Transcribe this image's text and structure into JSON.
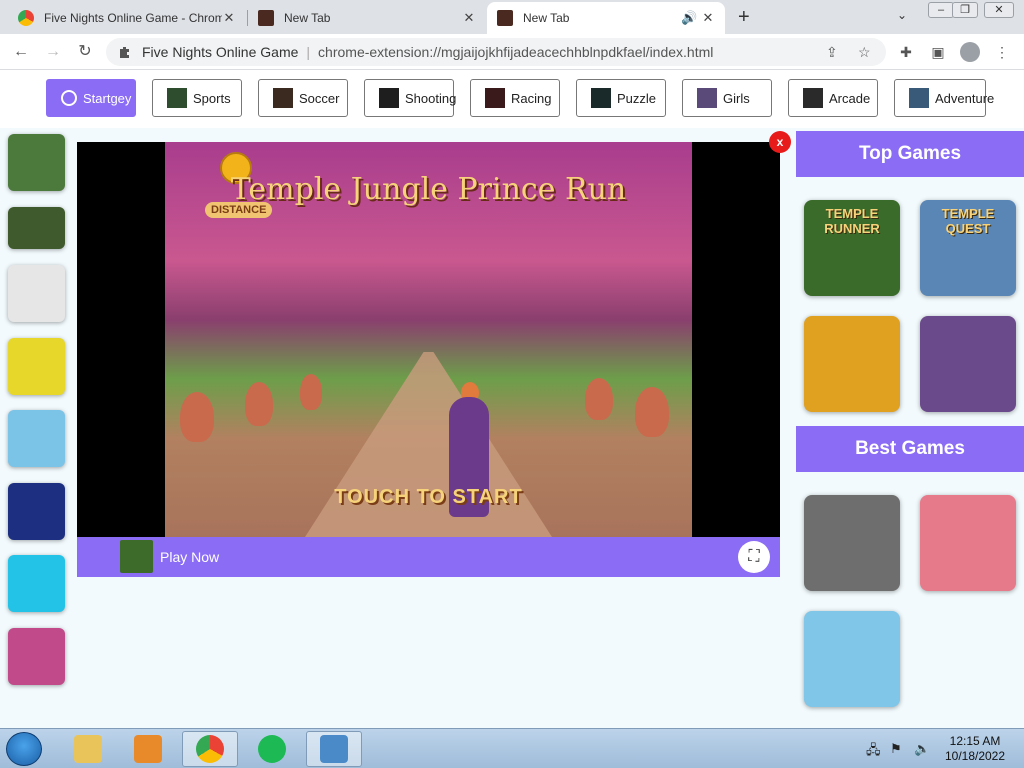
{
  "browser": {
    "tabs": [
      {
        "title": "Five Nights Online Game - Chrom",
        "active": false
      },
      {
        "title": "New Tab",
        "active": false
      },
      {
        "title": "New Tab",
        "active": true,
        "audio": true
      }
    ],
    "new_tab_symbol": "+",
    "address": {
      "site": "Five Nights Online Game",
      "url": "chrome-extension://mgjaijojkhfijadeacechhblnpdkfael/index.html"
    }
  },
  "categories": [
    {
      "label": "Startgey",
      "active": true
    },
    {
      "label": "Sports"
    },
    {
      "label": "Soccer"
    },
    {
      "label": "Shooting"
    },
    {
      "label": "Racing"
    },
    {
      "label": "Puzzle"
    },
    {
      "label": "Girls"
    },
    {
      "label": "Arcade"
    },
    {
      "label": "Adventure"
    }
  ],
  "left_thumbs": [
    {
      "icon": "thief-game-thumb",
      "color": "#4b7a3c"
    },
    {
      "icon": "forest-shooter-thumb",
      "color": "#3f5a2c"
    },
    {
      "icon": "stickman-thumb",
      "color": "#e6e6e6"
    },
    {
      "icon": "pipe-puzzle-thumb",
      "color": "#e7d72a"
    },
    {
      "icon": "car-racing-thumb",
      "color": "#7cc3e8"
    },
    {
      "icon": "huggy-wuggy-thumb",
      "color": "#1d2f80"
    },
    {
      "icon": "spider-hero-thumb",
      "color": "#22c3e6"
    },
    {
      "icon": "meteor-hunter-thumb",
      "color": "#c04a8a"
    }
  ],
  "game": {
    "title": "Temple Jungle Prince Run",
    "distance_label": "DISTANCE",
    "touch_label": "TOUCH TO START",
    "close_label": "x",
    "play_now": "Play Now"
  },
  "sidebar": {
    "top_title": "Top Games",
    "top_games": [
      {
        "label": "TEMPLE RUNNER",
        "color": "#3a6b2a"
      },
      {
        "label": "TEMPLE QUEST",
        "color": "#5a86b5"
      },
      {
        "label": "",
        "color": "#e0a020"
      },
      {
        "label": "",
        "color": "#6a4a8a"
      }
    ],
    "best_title": "Best Games",
    "best_games": [
      {
        "label": "",
        "color": "#6e6e6e"
      },
      {
        "label": "",
        "color": "#e67a8a"
      },
      {
        "label": "",
        "color": "#7fc6e8"
      }
    ]
  },
  "taskbar": {
    "time": "12:15 AM",
    "date": "10/18/2022"
  },
  "colors": {
    "accent": "#8b6cf5",
    "close_red": "#e81b1b"
  }
}
